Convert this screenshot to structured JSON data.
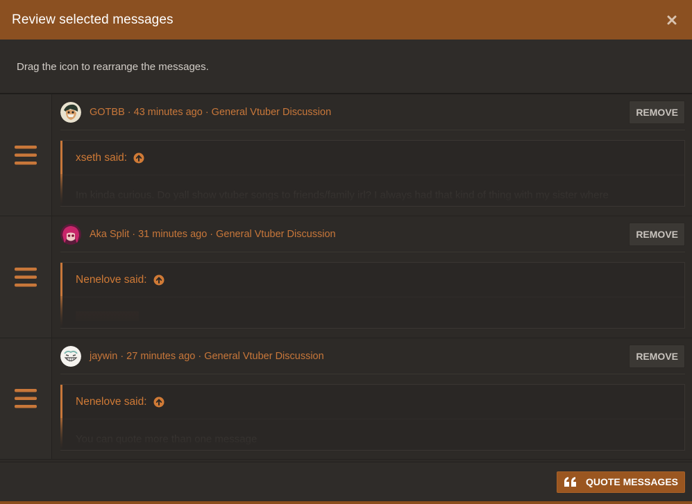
{
  "dialog": {
    "title": "Review selected messages",
    "instructions": "Drag the icon to rearrange the messages."
  },
  "messages": [
    {
      "meta": "GOTBB · 43 minutes ago · General Vtuber Discussion",
      "remove_label": "REMOVE",
      "quote_author": "xseth said:",
      "quote_text": "Im kinda curious. Do yall show vtuber songs to friends/family irl? I always had that kind of thing with my sister where"
    },
    {
      "meta": "Aka Split · 31 minutes ago · General Vtuber Discussion",
      "remove_label": "REMOVE",
      "quote_author": "Nenelove said:",
      "quote_text": ""
    },
    {
      "meta": "jaywin · 27 minutes ago · General Vtuber Discussion",
      "remove_label": "REMOVE",
      "quote_author": "Nenelove said:",
      "quote_text": "You can quote more than one message"
    }
  ],
  "footer": {
    "quote_button_label": "QUOTE MESSAGES"
  },
  "colors": {
    "header_bg": "#8b5021",
    "accent": "#c8773a",
    "button_bg": "#9a5620"
  },
  "icons": {
    "close": "close-icon",
    "drag": "drag-handle-icon",
    "quote_jump": "arrow-up-circle-icon",
    "quote_button": "quote-marks-icon"
  }
}
